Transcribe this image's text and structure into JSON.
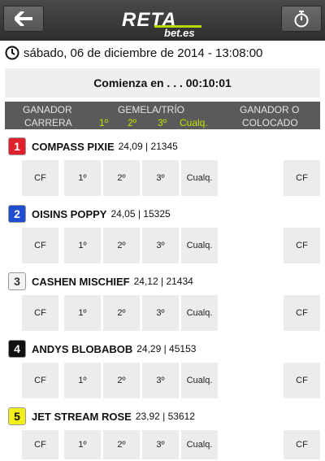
{
  "header": {
    "back_icon": "arrow-left-icon",
    "logo_main": "RETA",
    "logo_sub": "bet.es",
    "timer_icon": "stopwatch-icon"
  },
  "race": {
    "datetime": "sábado, 06 de diciembre de 2014 - 13:08:00",
    "countdown": "Comienza en . . . 00:10:01"
  },
  "columns": {
    "ganador": "GANADOR",
    "carrera": "CARRERA",
    "gemela": "GEMELA/TRÍO",
    "first": "1º",
    "second": "2º",
    "third": "3º",
    "any": "Cualq.",
    "ganador_o": "GANADOR O",
    "colocado": "COLOCADO"
  },
  "runners": [
    {
      "number": "1",
      "name": "COMPASS PIXIE",
      "odds": "24,09 | 21345",
      "badge_bg": "#e0202a",
      "badge_fg": "#ffffff"
    },
    {
      "number": "2",
      "name": "OISINS POPPY",
      "odds": "24,05 | 15325",
      "badge_bg": "#1f4fd0",
      "badge_fg": "#ffffff"
    },
    {
      "number": "3",
      "name": "CASHEN MISCHIEF",
      "odds": "24,12 | 21434",
      "badge_bg": "#f2f2f2",
      "badge_fg": "#333333"
    },
    {
      "number": "4",
      "name": "ANDYS BLOBABOB",
      "odds": "24,29 | 45153",
      "badge_bg": "#111111",
      "badge_fg": "#ffffff"
    },
    {
      "number": "5",
      "name": "JET STREAM ROSE",
      "odds": "23,92 | 53612",
      "badge_bg": "#f2ee1a",
      "badge_fg": "#111111"
    }
  ],
  "bet_cells": {
    "cf": "CF",
    "first": "1º",
    "second": "2º",
    "third": "3º",
    "any": "Cualq.",
    "cf_right": "CF"
  }
}
